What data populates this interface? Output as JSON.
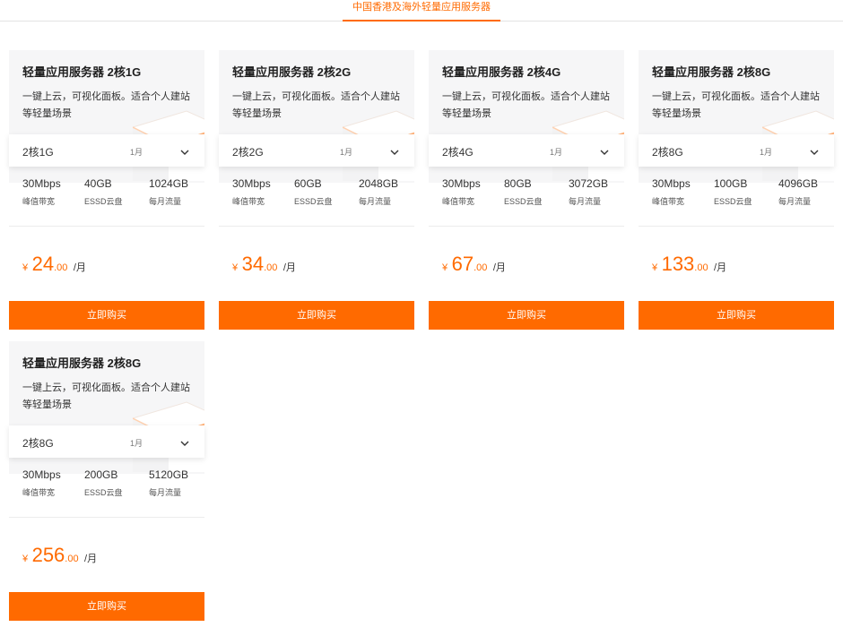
{
  "tabs": [
    {
      "label": "中国香港及海外轻量应用服务器"
    }
  ],
  "colors": {
    "accent": "#ff6a00",
    "card_bg": "#f6f6f7"
  },
  "icons": {
    "select": "chevron-down-icon",
    "illustration": "server-box-icon"
  },
  "products": [
    {
      "title": "轻量应用服务器 2核1G",
      "desc": "一键上云，可视化面板。适合个人建站等轻量场景",
      "config": "2核1G",
      "duration": "1月",
      "specs": [
        {
          "value": "30Mbps",
          "label": "峰值带宽"
        },
        {
          "value": "40GB",
          "label": "ESSD云盘"
        },
        {
          "value": "1024GB",
          "label": "每月流量"
        }
      ],
      "price": {
        "currency": "¥",
        "integer": "24",
        "decimal": ".00",
        "unit": "/月"
      },
      "buy_label": "立即购买"
    },
    {
      "title": "轻量应用服务器 2核2G",
      "desc": "一键上云，可视化面板。适合个人建站等轻量场景",
      "config": "2核2G",
      "duration": "1月",
      "specs": [
        {
          "value": "30Mbps",
          "label": "峰值带宽"
        },
        {
          "value": "60GB",
          "label": "ESSD云盘"
        },
        {
          "value": "2048GB",
          "label": "每月流量"
        }
      ],
      "price": {
        "currency": "¥",
        "integer": "34",
        "decimal": ".00",
        "unit": "/月"
      },
      "buy_label": "立即购买"
    },
    {
      "title": "轻量应用服务器 2核4G",
      "desc": "一键上云，可视化面板。适合个人建站等轻量场景",
      "config": "2核4G",
      "duration": "1月",
      "specs": [
        {
          "value": "30Mbps",
          "label": "峰值带宽"
        },
        {
          "value": "80GB",
          "label": "ESSD云盘"
        },
        {
          "value": "3072GB",
          "label": "每月流量"
        }
      ],
      "price": {
        "currency": "¥",
        "integer": "67",
        "decimal": ".00",
        "unit": "/月"
      },
      "buy_label": "立即购买"
    },
    {
      "title": "轻量应用服务器 2核8G",
      "desc": "一键上云，可视化面板。适合个人建站等轻量场景",
      "config": "2核8G",
      "duration": "1月",
      "specs": [
        {
          "value": "30Mbps",
          "label": "峰值带宽"
        },
        {
          "value": "100GB",
          "label": "ESSD云盘"
        },
        {
          "value": "4096GB",
          "label": "每月流量"
        }
      ],
      "price": {
        "currency": "¥",
        "integer": "133",
        "decimal": ".00",
        "unit": "/月"
      },
      "buy_label": "立即购买"
    },
    {
      "title": "轻量应用服务器 2核8G",
      "desc": "一键上云，可视化面板。适合个人建站等轻量场景",
      "config": "2核8G",
      "duration": "1月",
      "specs": [
        {
          "value": "30Mbps",
          "label": "峰值带宽"
        },
        {
          "value": "200GB",
          "label": "ESSD云盘"
        },
        {
          "value": "5120GB",
          "label": "每月流量"
        }
      ],
      "price": {
        "currency": "¥",
        "integer": "256",
        "decimal": ".00",
        "unit": "/月"
      },
      "buy_label": "立即购买"
    }
  ]
}
